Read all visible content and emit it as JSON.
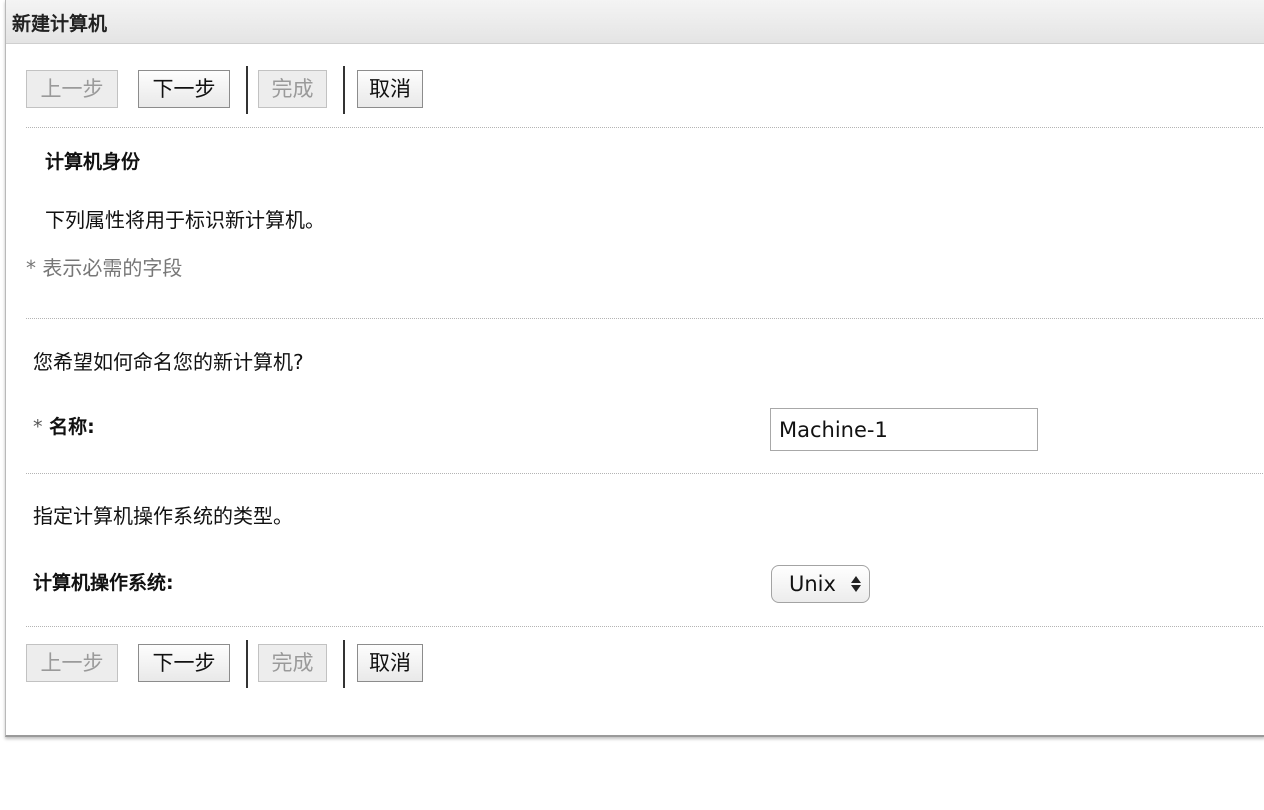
{
  "dialog": {
    "title": "新建计算机"
  },
  "buttons": {
    "prev": "上一步",
    "next": "下一步",
    "finish": "完成",
    "cancel": "取消"
  },
  "section": {
    "heading": "计算机身份",
    "description": "下列属性将用于标识新计算机。",
    "required_note": "* 表示必需的字段"
  },
  "name_group": {
    "question": "您希望如何命名您的新计算机?",
    "required_mark": "*",
    "label": "名称:",
    "value": "Machine-1"
  },
  "os_group": {
    "question": "指定计算机操作系统的类型。",
    "label": "计算机操作系统:",
    "selected": "Unix"
  }
}
